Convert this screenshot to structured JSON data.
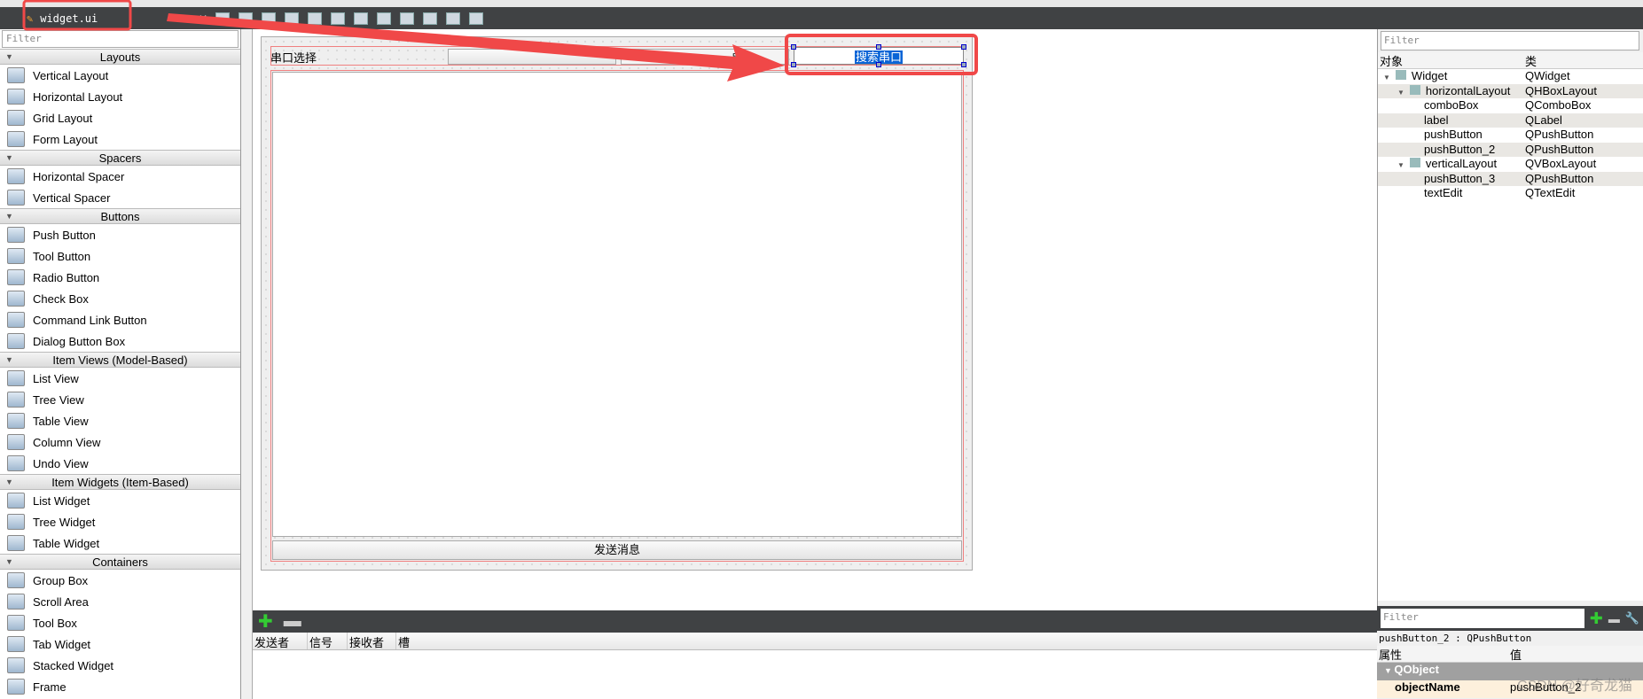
{
  "toolbar": {
    "file_tab": "widget.ui",
    "close": "✕",
    "icons": [
      "edit-widgets-icon",
      "edit-signals-icon",
      "edit-buddies-icon",
      "edit-tab-order-icon",
      "lay-out-horizontally-icon",
      "lay-out-vertically-icon",
      "horizontal-splitter-icon",
      "vertical-splitter-icon",
      "form-layout-icon",
      "grid-layout-icon",
      "break-layout-icon",
      "adjust-size-icon"
    ]
  },
  "widget_box": {
    "filter_placeholder": "Filter",
    "categories": [
      {
        "label": "Layouts",
        "items": [
          "Vertical Layout",
          "Horizontal Layout",
          "Grid Layout",
          "Form Layout"
        ]
      },
      {
        "label": "Spacers",
        "items": [
          "Horizontal Spacer",
          "Vertical Spacer"
        ]
      },
      {
        "label": "Buttons",
        "items": [
          "Push Button",
          "Tool Button",
          "Radio Button",
          "Check Box",
          "Command Link Button",
          "Dialog Button Box"
        ]
      },
      {
        "label": "Item Views (Model-Based)",
        "items": [
          "List View",
          "Tree View",
          "Table View",
          "Column View",
          "Undo View"
        ]
      },
      {
        "label": "Item Widgets (Item-Based)",
        "items": [
          "List Widget",
          "Tree Widget",
          "Table Widget"
        ]
      },
      {
        "label": "Containers",
        "items": [
          "Group Box",
          "Scroll Area",
          "Tool Box",
          "Tab Widget",
          "Stacked Widget",
          "Frame"
        ]
      }
    ]
  },
  "form": {
    "label_port": "串口选择",
    "label_partial": "串口",
    "search_button": "搜索串口",
    "send_button": "发送消息"
  },
  "signals": {
    "columns": [
      "发送者",
      "信号",
      "接收者",
      "槽"
    ]
  },
  "object_inspector": {
    "filter_placeholder": "Filter",
    "col_object": "对象",
    "col_class": "类",
    "rows": [
      {
        "name": "Widget",
        "class": "QWidget",
        "level": 0
      },
      {
        "name": "horizontalLayout",
        "class": "QHBoxLayout",
        "level": 1
      },
      {
        "name": "comboBox",
        "class": "QComboBox",
        "level": 2
      },
      {
        "name": "label",
        "class": "QLabel",
        "level": 2
      },
      {
        "name": "pushButton",
        "class": "QPushButton",
        "level": 2
      },
      {
        "name": "pushButton_2",
        "class": "QPushButton",
        "level": 2
      },
      {
        "name": "verticalLayout",
        "class": "QVBoxLayout",
        "level": 1
      },
      {
        "name": "pushButton_3",
        "class": "QPushButton",
        "level": 2
      },
      {
        "name": "textEdit",
        "class": "QTextEdit",
        "level": 2
      }
    ]
  },
  "property_editor": {
    "filter_placeholder": "Filter",
    "selected": "pushButton_2 : QPushButton",
    "col_property": "属性",
    "col_value": "值",
    "group": "QObject",
    "prop_name": "objectName",
    "prop_value": "pushButton_2",
    "watermark": "CSDN @好奇龙猫"
  },
  "annotation_color": "#f04848"
}
